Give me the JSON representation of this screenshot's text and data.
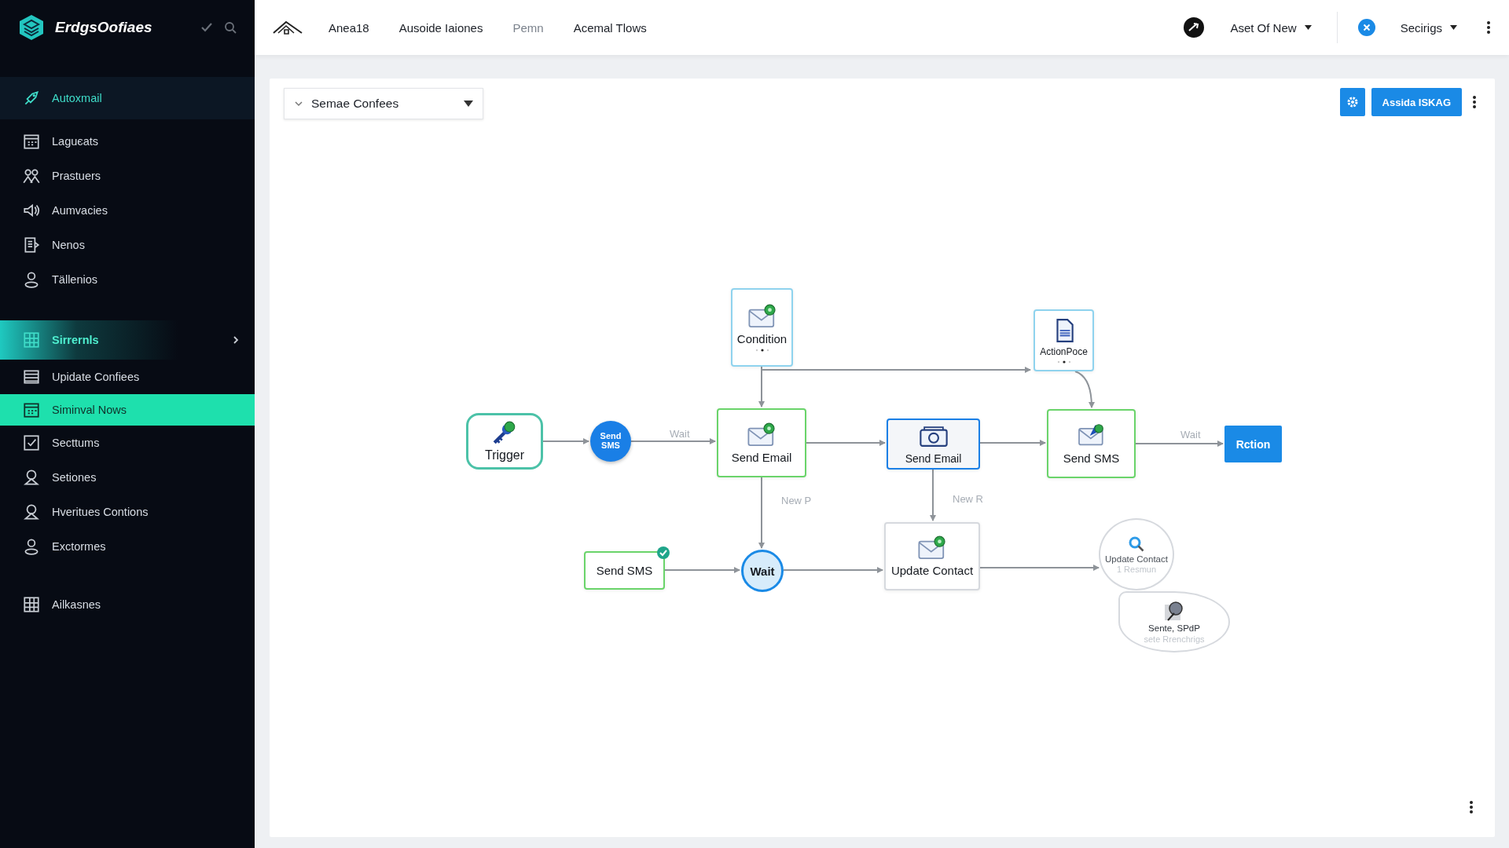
{
  "app": {
    "name": "ErdgsOofiaes"
  },
  "sidebar": {
    "sections": [
      {
        "items": [
          {
            "label": "Autoxmail",
            "kind": "header",
            "selected": false
          },
          {
            "label": "Laguєats",
            "kind": "item",
            "selected": false
          },
          {
            "label": "Prastuers",
            "kind": "item",
            "selected": false
          },
          {
            "label": "Aumvacies",
            "kind": "item",
            "selected": false
          },
          {
            "label": "Nenos",
            "kind": "item",
            "selected": false
          },
          {
            "label": "Tällenios",
            "kind": "item",
            "selected": false
          }
        ]
      },
      {
        "items": [
          {
            "label": "Sirrernls",
            "kind": "group",
            "selected": false
          },
          {
            "label": "Upidate Confiees",
            "kind": "item",
            "selected": false
          },
          {
            "label": "Siminval Nows",
            "kind": "item",
            "selected": true
          },
          {
            "label": "Secttums",
            "kind": "item",
            "selected": false
          },
          {
            "label": "Setiones",
            "kind": "item",
            "selected": false
          },
          {
            "label": "Hveritues Contions",
            "kind": "item",
            "selected": false
          },
          {
            "label": "Exctormes",
            "kind": "item",
            "selected": false
          }
        ]
      },
      {
        "items": [
          {
            "label": "Ailkasnes",
            "kind": "item",
            "selected": false
          }
        ]
      }
    ]
  },
  "topbar": {
    "nav": [
      {
        "label": "Anea18",
        "disabled": false
      },
      {
        "label": "Ausoide Iaiones",
        "disabled": false
      },
      {
        "label": "Pemn",
        "disabled": true
      },
      {
        "label": "Acemal Tlows",
        "disabled": false
      }
    ],
    "account": "Aset Of New",
    "settings": "Secirigs"
  },
  "panel": {
    "dropdown": "Semae Confees",
    "primary_button": "Assida ISKAG",
    "nodes": [
      {
        "kind": "trigger",
        "label": "Trigger",
        "color": "#4cc2a8"
      },
      {
        "kind": "solid-circle",
        "label": "Send SMS",
        "color": "#1a7fe6"
      },
      {
        "kind": "mail-card",
        "label": "Condition",
        "color": "#8fd3ee"
      },
      {
        "kind": "mail-card",
        "label": "Send Email",
        "color": "#6ad46a"
      },
      {
        "kind": "doc-card",
        "label": "ActionPoce",
        "color": "#8fd3ee"
      },
      {
        "kind": "camera-card",
        "label": "Send Email",
        "color": "#1a7fe6"
      },
      {
        "kind": "pin-card",
        "label": "Send SMS",
        "color": "#6ad46a"
      },
      {
        "kind": "action-button",
        "label": "Rction",
        "color": "#1a8ae6"
      },
      {
        "kind": "check-card",
        "label": "Send SMS",
        "color": "#6ad46a"
      },
      {
        "kind": "outline-circle",
        "label": "Wait",
        "color": "#1a8ae6"
      },
      {
        "kind": "mail-card",
        "label": "Update Contact",
        "color": "#d6d9de"
      },
      {
        "kind": "search-bubble",
        "label": "Update Contact",
        "sublabel": "1 Resmun",
        "color": "#d6d9de"
      },
      {
        "kind": "chat-bubble",
        "label": "Sente, SPdP",
        "sublabel": "sete Rrenchrigs",
        "color": "#d6d9de"
      }
    ],
    "edge_labels": [
      "Wait",
      "New P",
      "New R",
      "Wait"
    ]
  }
}
